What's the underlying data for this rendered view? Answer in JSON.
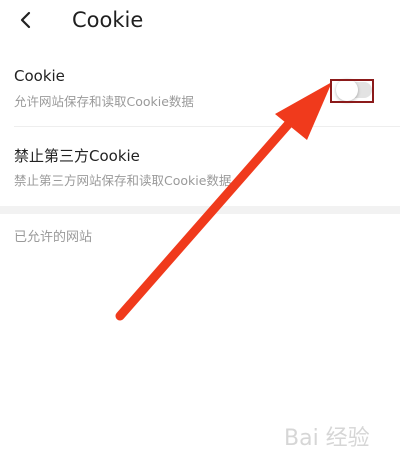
{
  "header": {
    "back_icon": "chevron-left-icon",
    "title": "Cookie"
  },
  "settings": {
    "cookie": {
      "title": "Cookie",
      "description": "允许网站保存和读取Cookie数据",
      "toggle_on": false
    },
    "third_party": {
      "title": "禁止第三方Cookie",
      "description": "禁止第三方网站保存和读取Cookie数据"
    }
  },
  "allowed_sites": {
    "label": "已允许的网站"
  },
  "annotation": {
    "arrow_color": "#f03a1c",
    "box_color": "#8b1a1a"
  },
  "watermark": {
    "text": "Bai 经验"
  }
}
